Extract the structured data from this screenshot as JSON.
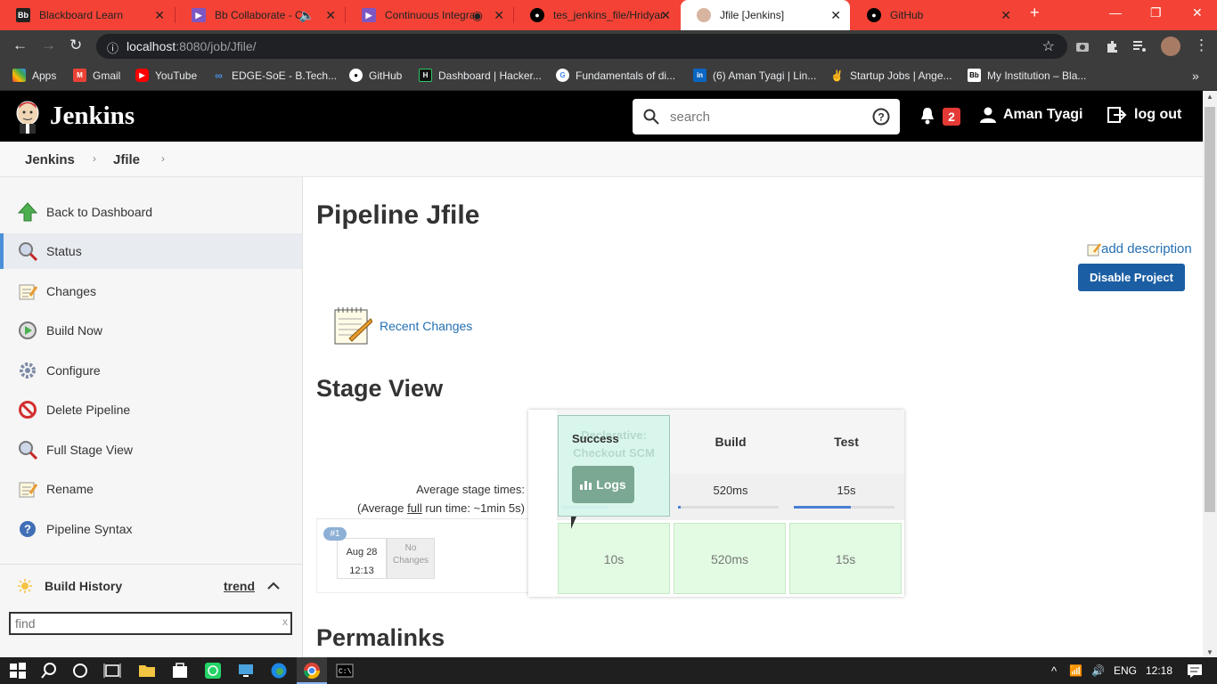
{
  "browser": {
    "tabs": [
      {
        "title": "Blackboard Learn"
      },
      {
        "title": "Bb Collaborate - Cc"
      },
      {
        "title": "Continuous Integra"
      },
      {
        "title": "tes_jenkins_file/Hridyan"
      },
      {
        "title": "Jfile [Jenkins]"
      },
      {
        "title": "GitHub"
      }
    ],
    "url_host": "localhost",
    "url_rest": ":8080/job/Jfile/",
    "bookmarks": [
      {
        "label": "Apps"
      },
      {
        "label": "Gmail"
      },
      {
        "label": "YouTube"
      },
      {
        "label": "EDGE-SoE - B.Tech..."
      },
      {
        "label": "GitHub"
      },
      {
        "label": "Dashboard | Hacker..."
      },
      {
        "label": "Fundamentals of di..."
      },
      {
        "label": "(6) Aman Tyagi | Lin..."
      },
      {
        "label": "Startup Jobs | Ange..."
      },
      {
        "label": "My Institution – Bla..."
      }
    ]
  },
  "header": {
    "title": "Jenkins",
    "search_placeholder": "search",
    "notifications": "2",
    "user": "Aman Tyagi",
    "logout": "log out"
  },
  "breadcrumb": {
    "root": "Jenkins",
    "job": "Jfile"
  },
  "sidebar": {
    "items": [
      {
        "label": "Back to Dashboard"
      },
      {
        "label": "Status"
      },
      {
        "label": "Changes"
      },
      {
        "label": "Build Now"
      },
      {
        "label": "Configure"
      },
      {
        "label": "Delete Pipeline"
      },
      {
        "label": "Full Stage View"
      },
      {
        "label": "Rename"
      },
      {
        "label": "Pipeline Syntax"
      }
    ],
    "build_history": "Build History",
    "trend": "trend",
    "find_placeholder": "find",
    "clear": "x"
  },
  "main": {
    "title": "Pipeline Jfile",
    "add_description": "add description",
    "disable_project": "Disable Project",
    "recent_changes": "Recent Changes",
    "stage_view": "Stage View",
    "permalinks": "Permalinks"
  },
  "stage_view": {
    "avg_stage_times": "Average stage times:",
    "avg_full_prefix": "(Average ",
    "avg_full_word": "full",
    "avg_full_suffix": " run time: ~1min 5s)",
    "stages": [
      {
        "name": "Declarative: Checkout SCM",
        "avg": "",
        "build": "10s",
        "bar_fraction": 0.45
      },
      {
        "name": "Build",
        "avg": "520ms",
        "build": "520ms",
        "bar_fraction": 0.03
      },
      {
        "name": "Test",
        "avg": "15s",
        "build": "15s",
        "bar_fraction": 0.57
      }
    ],
    "build": {
      "number": "#1",
      "date": "Aug 28",
      "time": "12:13",
      "changes": "No Changes"
    },
    "popup": {
      "status": "Success",
      "logs": "Logs",
      "ghost_line1": "Declarative:",
      "ghost_line2": "Checkout SCM"
    }
  },
  "taskbar": {
    "lang": "ENG",
    "time": "12:18"
  }
}
